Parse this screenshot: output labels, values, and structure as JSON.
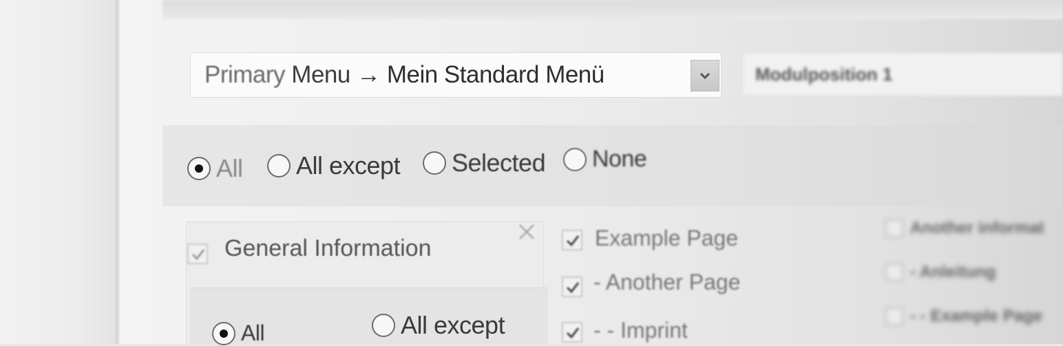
{
  "menu_assignment": {
    "selected_prefix": "Primary",
    "selected_menu_word": "Menu",
    "selected_arrow": "→",
    "selected_target": "Mein Standard Menü",
    "dropdown_icon": "chevron-down-icon"
  },
  "module_position": {
    "value": "Modulposition 1"
  },
  "page_assignment": {
    "options": [
      "All",
      "All except",
      "Selected",
      "None"
    ],
    "selected": "All"
  },
  "general_info": {
    "checkbox_checked": true,
    "label": "General Information",
    "close_icon": "close-icon",
    "sub_options": [
      "All",
      "All except"
    ],
    "sub_selected": "All"
  },
  "pages": [
    {
      "label": "Example Page",
      "checked": true
    },
    {
      "label": "- Another Page",
      "checked": true
    },
    {
      "label": "- - Imprint",
      "checked": true
    }
  ],
  "right_column": {
    "items": [
      "Another informat",
      "- Anleitung",
      "- - Example Page"
    ]
  },
  "colors": {
    "panel_bg": "#eeeeee",
    "text": "#333333",
    "radio_dot": "#111111",
    "checkmark": "#444444"
  }
}
